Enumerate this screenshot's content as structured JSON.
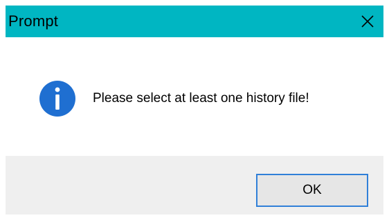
{
  "window": {
    "title": "Prompt"
  },
  "dialog": {
    "message": "Please select at least one history file!",
    "icon": "info-icon"
  },
  "buttons": {
    "ok_label": "OK"
  },
  "colors": {
    "titlebar": "#00b6c2",
    "footer": "#efefef",
    "ok_border": "#2f7fd8",
    "info_icon": "#1f6fd1"
  }
}
